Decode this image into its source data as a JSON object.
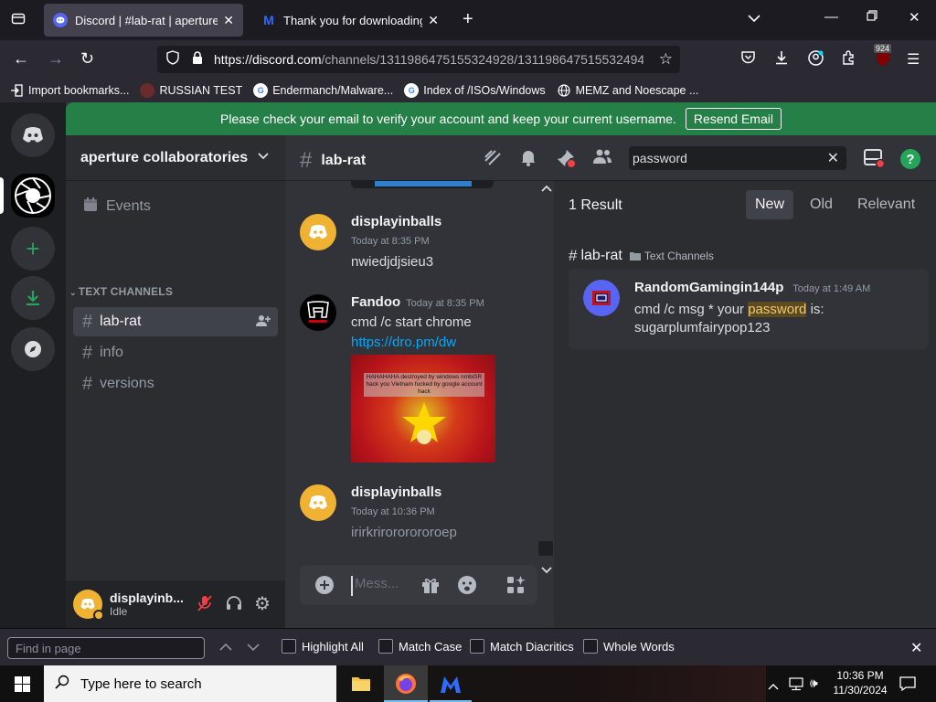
{
  "browser": {
    "tabs": [
      {
        "title": "Discord | #lab-rat | aperture coll",
        "active": true
      },
      {
        "title": "Thank you for downloading Ma",
        "active": false
      }
    ],
    "url_host": "https://discord.com",
    "url_rest": "/channels/1311986475155324928/131198647515532494",
    "bookmarks": [
      "Import bookmarks...",
      "RUSSIAN TEST",
      "Endermanch/Malware...",
      "Index of /ISOs/Windows",
      "MEMZ and Noescape ..."
    ],
    "badge_count": "924"
  },
  "discord": {
    "banner_text": "Please check your email to verify your account and keep your current username.",
    "banner_button": "Resend Email",
    "server_name": "aperture collaboratories",
    "events_label": "Events",
    "text_channels_label": "TEXT CHANNELS",
    "channels": [
      "lab-rat",
      "info",
      "versions"
    ],
    "active_channel": "lab-rat",
    "user": {
      "name": "displayinb...",
      "status": "Idle"
    },
    "composer_placeholder": "Mess...",
    "search_query": "password",
    "messages": [
      {
        "author": "displayinballs",
        "time": "Today at 8:35 PM",
        "text": "nwiedjdjsieu3"
      },
      {
        "author": "Fandoo",
        "time": "Today at 8:35 PM",
        "text": "cmd /c start chrome",
        "link": "https://dro.pm/dw",
        "image_caption": "HAHAHAHA destroyed by windows nmbiSR hack you Vietnam fucked by google account hack"
      },
      {
        "author": "displayinballs",
        "time": "Today at 10:36 PM",
        "text": "irirkrirororororoep"
      }
    ],
    "results": {
      "count_label": "1 Result",
      "sort_tabs": [
        "New",
        "Old",
        "Relevant"
      ],
      "active_sort": "New",
      "channel": "lab-rat",
      "category": "Text Channels",
      "result": {
        "author": "RandomGamingin144p",
        "time": "Today at 1:49 AM",
        "text_before": "cmd /c msg * your ",
        "highlight": "password",
        "text_after": " is:",
        "line2": "sugarplumfairypop123"
      }
    }
  },
  "findbar": {
    "placeholder": "Find in page",
    "options": [
      "Highlight All",
      "Match Case",
      "Match Diacritics",
      "Whole Words"
    ]
  },
  "taskbar": {
    "search_placeholder": "Type here to search",
    "time": "10:36 PM",
    "date": "11/30/2024"
  },
  "colors": {
    "accent_green": "#248046",
    "discord_blurple": "#5865f2",
    "avatar_yellow": "#f0b232",
    "link_blue": "#00a8fc",
    "highlight_bg": "#5c4a23"
  }
}
